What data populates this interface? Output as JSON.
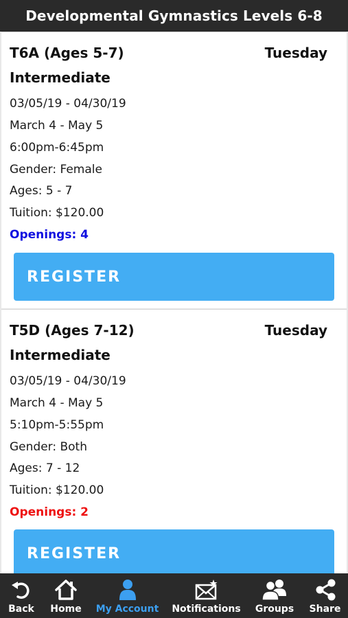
{
  "header": {
    "title": "Developmental Gymnastics Levels 6-8"
  },
  "classes": [
    {
      "name": "T6A (Ages 5-7)",
      "day": "Tuesday",
      "level": "Intermediate",
      "date_range": "03/05/19 - 04/30/19",
      "month_range": "March 4 - May 5",
      "time": "6:00pm-6:45pm",
      "gender": "Gender: Female",
      "ages": "Ages: 5 - 7",
      "tuition": "Tuition: $120.00",
      "openings": "Openings: 4",
      "openings_color": "#1010e0",
      "register_label": "REGISTER"
    },
    {
      "name": "T5D (Ages 7-12)",
      "day": "Tuesday",
      "level": "Intermediate",
      "date_range": "03/05/19 - 04/30/19",
      "month_range": "March 4 - May 5",
      "time": "5:10pm-5:55pm",
      "gender": "Gender: Both",
      "ages": "Ages: 7 - 12",
      "tuition": "Tuition: $120.00",
      "openings": "Openings: 2",
      "openings_color": "#ee1111",
      "register_label": "REGISTER"
    }
  ],
  "tabbar": {
    "items": [
      {
        "label": "Back",
        "icon": "back-icon"
      },
      {
        "label": "Home",
        "icon": "home-icon"
      },
      {
        "label": "My Account",
        "icon": "user-icon",
        "active": true
      },
      {
        "label": "Notifications",
        "icon": "notifications-icon"
      },
      {
        "label": "Groups",
        "icon": "groups-icon"
      },
      {
        "label": "Share",
        "icon": "share-icon"
      }
    ]
  },
  "colors": {
    "accent": "#43adf3",
    "active_tab": "#3c9ff0",
    "bar": "#2a2a2a"
  }
}
